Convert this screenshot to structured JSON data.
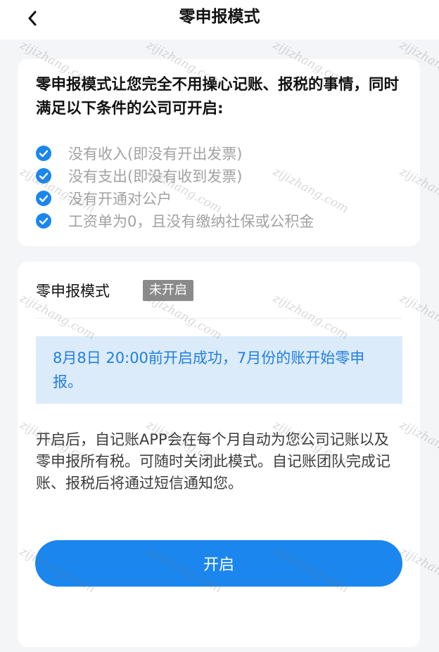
{
  "header": {
    "title": "零申报模式"
  },
  "intro": {
    "text": "零申报模式让您完全不用操心记账、报税的事情，同时满足以下条件的公司可开启:",
    "conditions": [
      "没有收入(即没有开出发票)",
      "没有支出(即没有收到发票)",
      "没有开通对公户",
      "工资单为0，且没有缴纳社保或公积金"
    ]
  },
  "mode": {
    "label": "零申报模式",
    "status": "未开启",
    "notice": "8月8日 20:00前开启成功，7月份的账开始零申报。",
    "description": "开启后，自记账APP会在每个月自动为您公司记账以及零申报所有税。可随时关闭此模式。自记账团队完成记账、报税后将通过短信通知您。",
    "button_label": "开启"
  },
  "watermark": {
    "text": "zijizhang.com"
  },
  "colors": {
    "accent": "#1a86ee",
    "notice_bg": "#dcebf9",
    "notice_text": "#1f7fe3",
    "badge_bg": "#8a8a8a",
    "check": "#1a86ee"
  }
}
